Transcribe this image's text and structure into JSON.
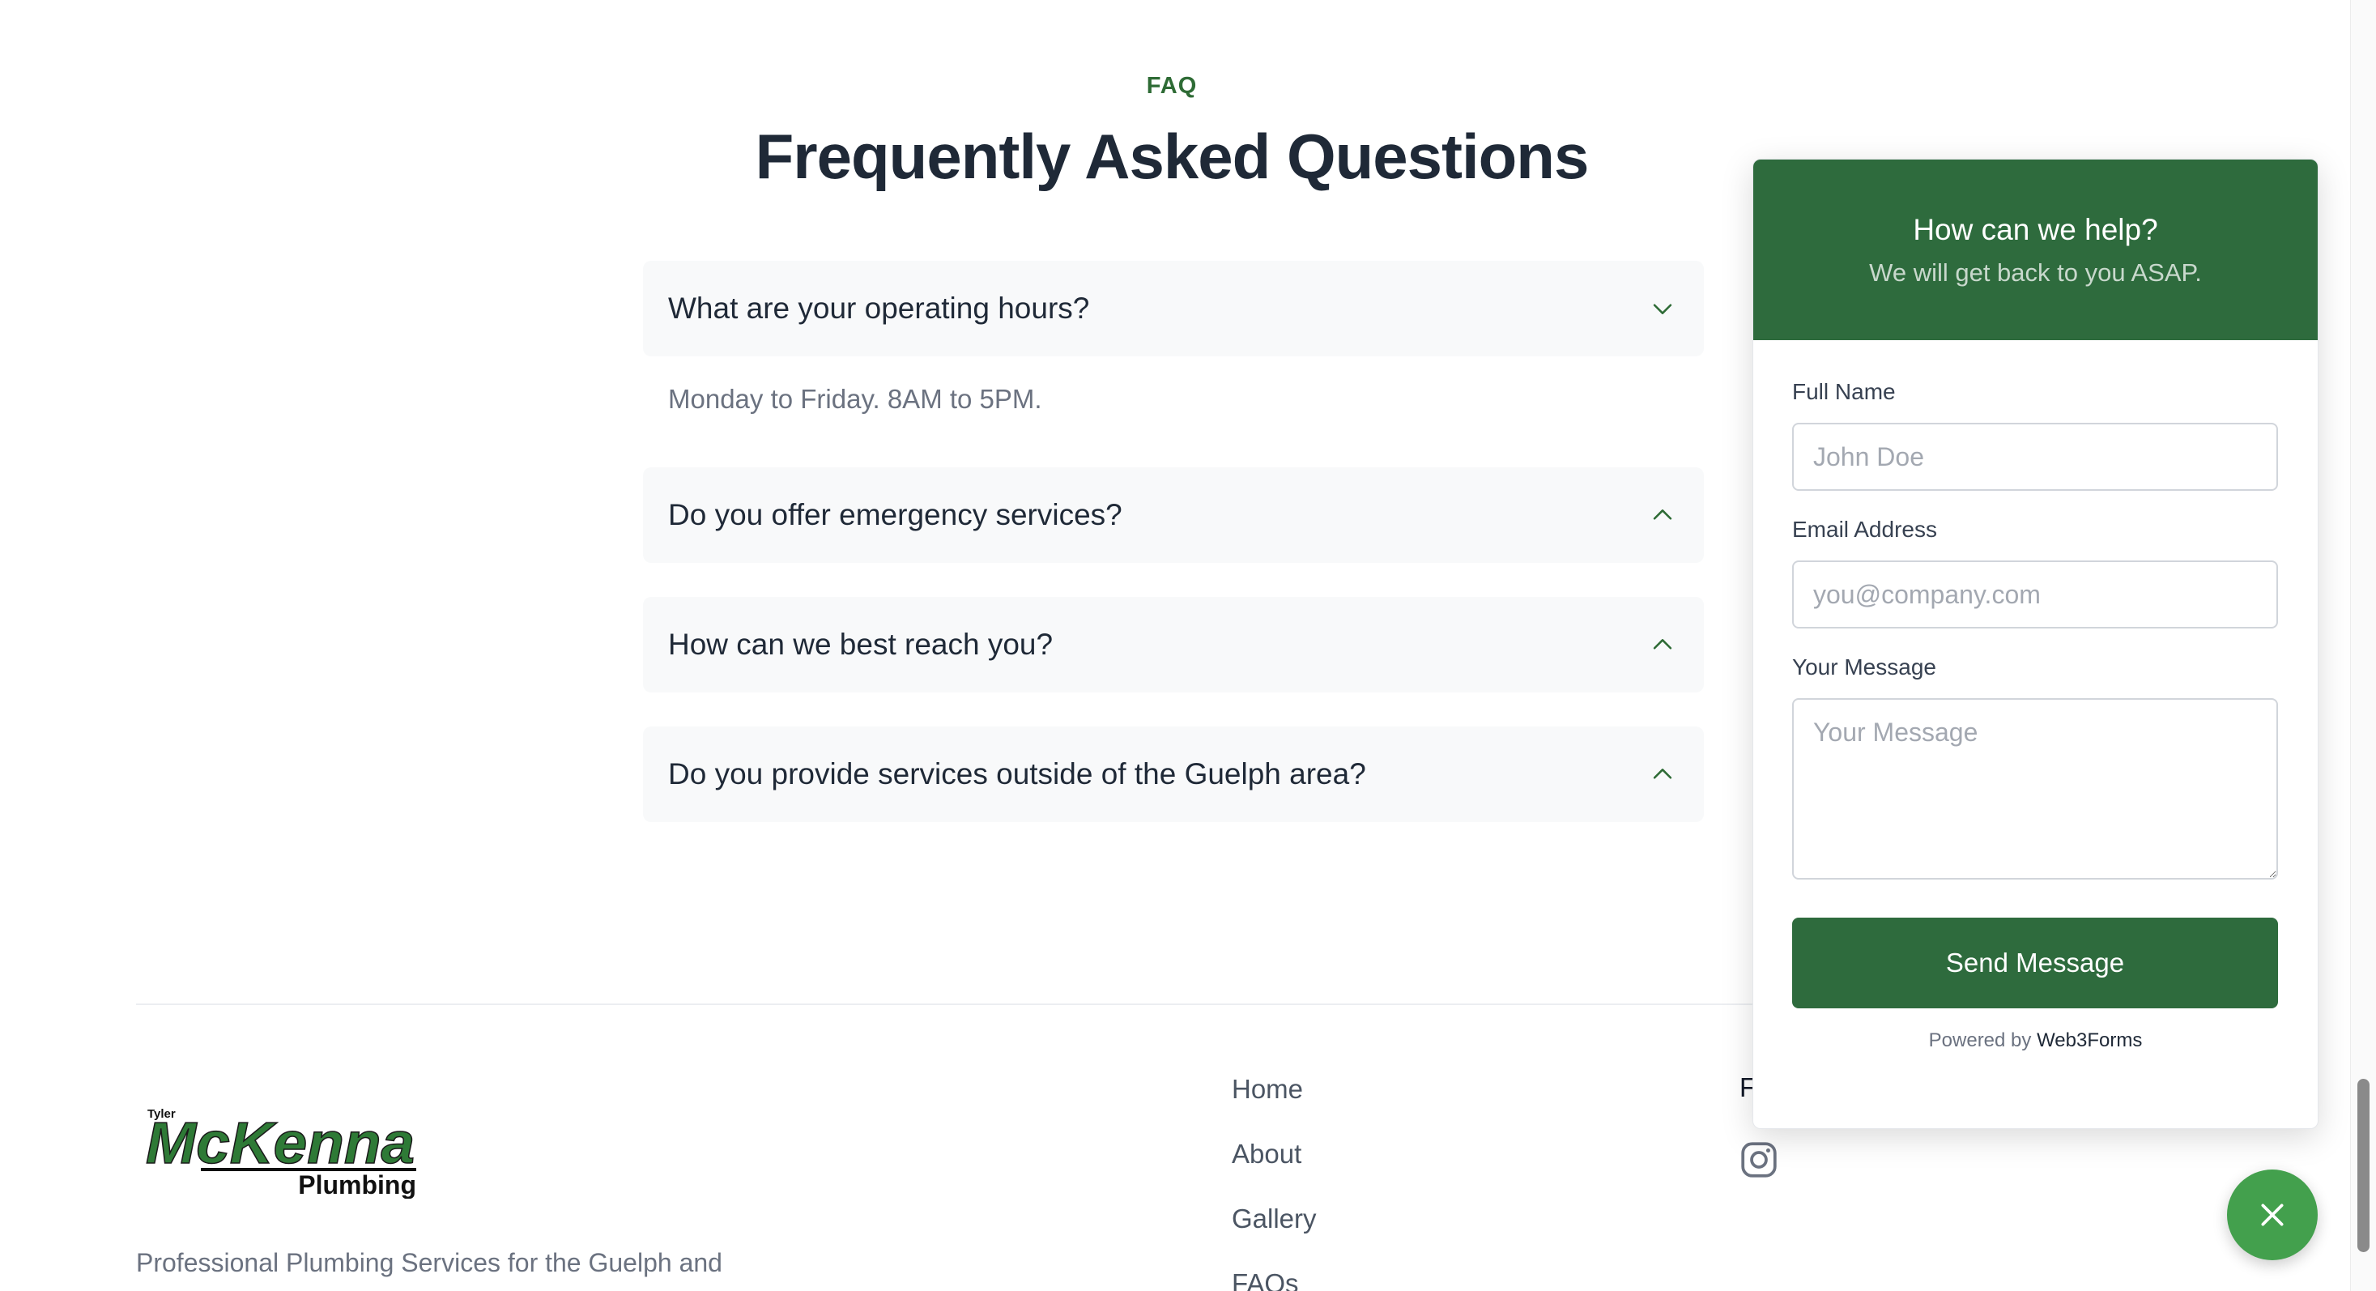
{
  "faq": {
    "eyebrow": "FAQ",
    "title": "Frequently Asked Questions",
    "items": [
      {
        "question": "What are your operating hours?",
        "answer": "Monday to Friday. 8AM to 5PM.",
        "expanded": true
      },
      {
        "question": "Do you offer emergency services?",
        "expanded": false
      },
      {
        "question": "How can we best reach you?",
        "expanded": false
      },
      {
        "question": "Do you provide services outside of the Guelph area?",
        "expanded": false
      }
    ]
  },
  "footer": {
    "logo": {
      "top": "Tyler",
      "main": "McKenna",
      "sub": "Plumbing"
    },
    "description": "Professional Plumbing Services for the Guelph and",
    "links": [
      "Home",
      "About",
      "Gallery",
      "FAQs"
    ],
    "partial_heading": "F",
    "social_icon": "instagram-icon"
  },
  "contact_widget": {
    "title": "How can we help?",
    "subtitle": "We will get back to you ASAP.",
    "fields": {
      "name_label": "Full Name",
      "name_placeholder": "John Doe",
      "email_label": "Email Address",
      "email_placeholder": "you@company.com",
      "message_label": "Your Message",
      "message_placeholder": "Your Message"
    },
    "submit_label": "Send Message",
    "powered_prefix": "Powered by",
    "powered_brand": "Web3Forms",
    "close_icon": "close-icon"
  },
  "colors": {
    "brand_green": "#2e6b3d",
    "fab_green": "#43a04d",
    "eyebrow_green": "#2e6b35",
    "text_dark": "#1f2937",
    "text_muted": "#6b7280"
  }
}
